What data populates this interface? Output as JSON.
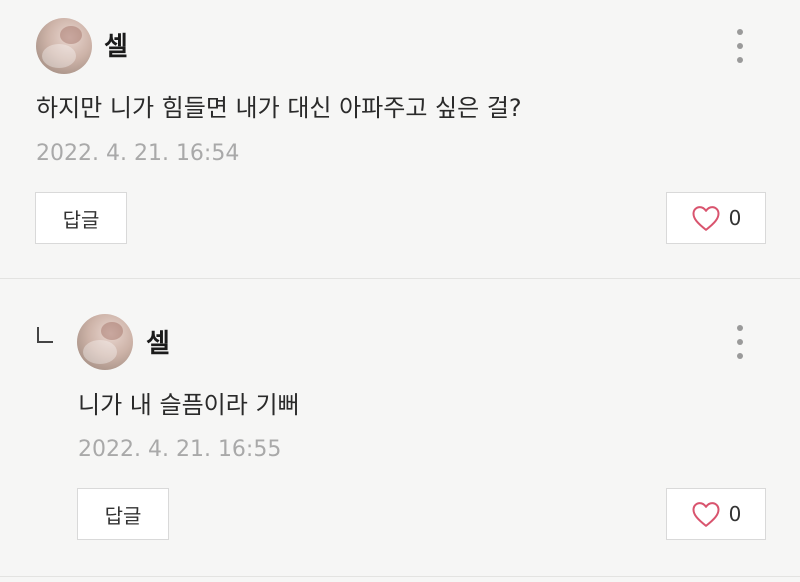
{
  "comments": [
    {
      "author": "셀",
      "text": "하지만 니가 힘들면 내가 대신 아파주고 싶은 걸?",
      "timestamp": "2022. 4. 21. 16:54",
      "reply_label": "답글",
      "like_count": "0"
    },
    {
      "author": "셀",
      "text": "니가 내 슬픔이라 기뻐",
      "timestamp": "2022. 4. 21. 16:55",
      "reply_label": "답글",
      "like_count": "0"
    }
  ],
  "icons": {
    "more": "more-vertical-icon",
    "like": "heart-outline-icon",
    "reply_indicator": "reply-arrow-icon"
  },
  "colors": {
    "background": "#f6f6f5",
    "like_heart": "#d9546e",
    "timestamp": "#a9a9a9"
  }
}
